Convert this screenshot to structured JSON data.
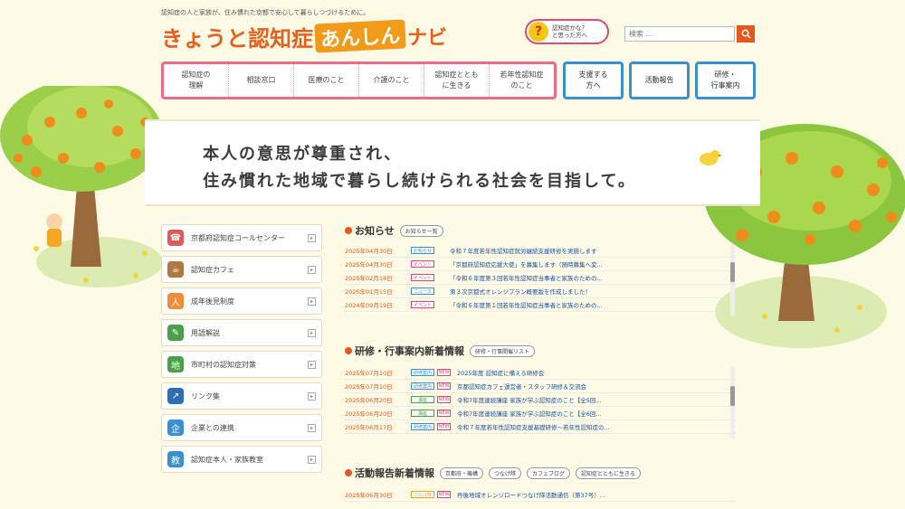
{
  "header": {
    "tagline": "認知症の人と家族が、住み慣れた京都で安心して暮らしつづけるために。",
    "logo_main": "きょうと認知症",
    "logo_highlight": "あんしん",
    "logo_suffix": "ナビ",
    "help_label": "認知症かな？\nと思った方へ",
    "search_placeholder": "検索 ..."
  },
  "nav": {
    "pink_items": [
      "認知症の\n理解",
      "相談窓口",
      "医療のこと",
      "介護のこと",
      "認知症ととも\nに生きる",
      "若年性認知症\nのこと"
    ],
    "blue_items": [
      "支援する\n方へ",
      "活動報告",
      "研修・\n行事案内"
    ]
  },
  "banner": {
    "line1": "本人の意思が尊重され、",
    "line2": "住み慣れた地域で暮らし続けられる社会を目指して。"
  },
  "side_links": [
    {
      "label": "京都府認知症コールセンター",
      "color": "#e05a5a",
      "icon": "☎"
    },
    {
      "label": "認知症カフェ",
      "color": "#b07840",
      "icon": "☕"
    },
    {
      "label": "成年後見制度",
      "color": "#f08c3a",
      "icon": "人"
    },
    {
      "label": "用語解説",
      "color": "#4aa04a",
      "icon": "✎"
    },
    {
      "label": "市町村の認知症対策",
      "color": "#4aa04a",
      "icon": "地"
    },
    {
      "label": "リンク集",
      "color": "#2a6fb8",
      "icon": "↗"
    },
    {
      "label": "企業との連携",
      "color": "#3a8fd0",
      "icon": "企"
    },
    {
      "label": "認知症本人・家族教室",
      "color": "#3a8fd0",
      "icon": "教"
    }
  ],
  "news": {
    "title": "お知らせ",
    "list_button": "お知らせ一覧",
    "rows": [
      {
        "date": "2025年04月30日",
        "tag": "お知らせ",
        "tag_color": "#3a8fd0",
        "text": "令和７年度若年性認知症就労継続支援研修を実施します"
      },
      {
        "date": "2025年04月30日",
        "tag": "イベント",
        "tag_color": "#e8417a",
        "text": "「京都府認知症応援大使」を募集します（随時募集へ変..."
      },
      {
        "date": "2025年02月18日",
        "tag": "イベント",
        "tag_color": "#e8417a",
        "text": "「令和６年度第３回若年性認知症当事者と家族のための..."
      },
      {
        "date": "2025年01月15日",
        "tag": "ニュース",
        "tag_color": "#3a8fd0",
        "text": "第３次京都式オレンジプラン概要版を作成しました！"
      },
      {
        "date": "2024年09月19日",
        "tag": "イベント",
        "tag_color": "#e8417a",
        "text": "「令和６年度第１回若年性認知症当事者と家族のための..."
      }
    ]
  },
  "events": {
    "title": "研修・行事案内新着情報",
    "list_button": "研修・行事開催リスト",
    "rows": [
      {
        "date": "2025年07月10日",
        "tag": "研修案内",
        "tag_color": "#3a8fd0",
        "new": "NEW",
        "text": "2025年度 認知症に備える研修会"
      },
      {
        "date": "2025年07月10日",
        "tag": "研修案内",
        "tag_color": "#3a8fd0",
        "new": "NEW",
        "text": "京都認知症カフェ運営者・スタッフ研修＆交流会"
      },
      {
        "date": "2025年06月20日",
        "tag": "講座",
        "tag_color": "#4aa04a",
        "new": "NEW",
        "text": "令和7年度連続講座 家族が学ぶ認知症のこと【全5回..."
      },
      {
        "date": "2025年06月20日",
        "tag": "講座",
        "tag_color": "#4aa04a",
        "new": "NEW",
        "text": "令和7年度連続講座 家族が学ぶ認知症のこと【全6回..."
      },
      {
        "date": "2025年06月17日",
        "tag": "研修案内",
        "tag_color": "#3a8fd0",
        "new": "NEW",
        "text": "令和７年度若年性認知症支援基礎研修～若年性認知症の..."
      }
    ]
  },
  "reports": {
    "title": "活動報告新着情報",
    "buttons": [
      "京都府・機構",
      "つなげ隊",
      "カフェブログ",
      "認知症とともに生きる"
    ],
    "rows": [
      {
        "date": "2025年06月30日",
        "tag": "つなげ隊",
        "tag_color": "#f0a020",
        "new": "NEW",
        "text": "丹後地域オレンジロードつなげ隊活動通信（第37号）..."
      }
    ]
  }
}
